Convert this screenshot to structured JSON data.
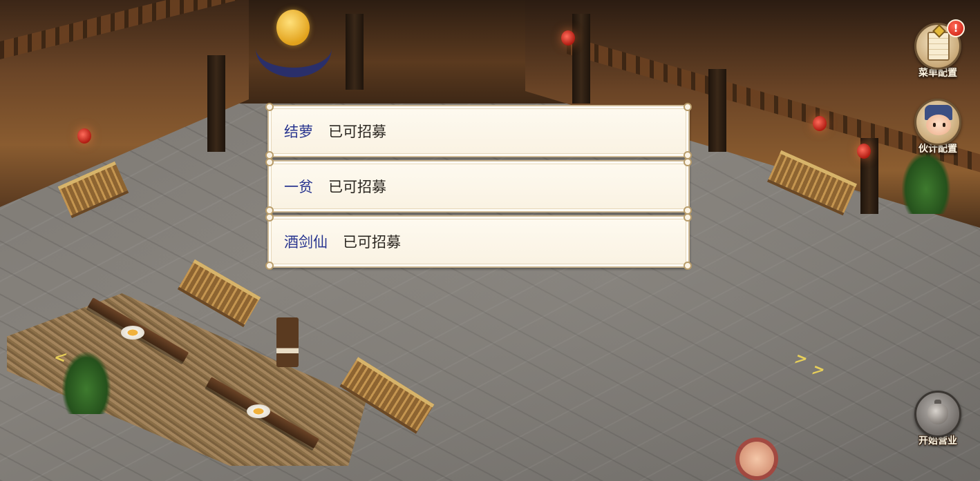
{
  "recruits": [
    {
      "name": "结萝",
      "status": "已可招募"
    },
    {
      "name": "一贫",
      "status": "已可招募"
    },
    {
      "name": "酒剑仙",
      "status": "已可招募"
    }
  ],
  "side_menu": {
    "menu_config_label": "菜单配置",
    "menu_config_badge": "!",
    "staff_config_label": "伙计配置",
    "start_business_label": "开始营业"
  },
  "colors": {
    "recruit_name": "#27348f",
    "recruit_status": "#2a2620",
    "dialog_bg": "#fefaf0",
    "alert": "#c8170c"
  },
  "icons": [
    "scroll-icon",
    "alert-icon",
    "staff-avatar-icon",
    "pot-icon",
    "pointer-hand-icon"
  ]
}
